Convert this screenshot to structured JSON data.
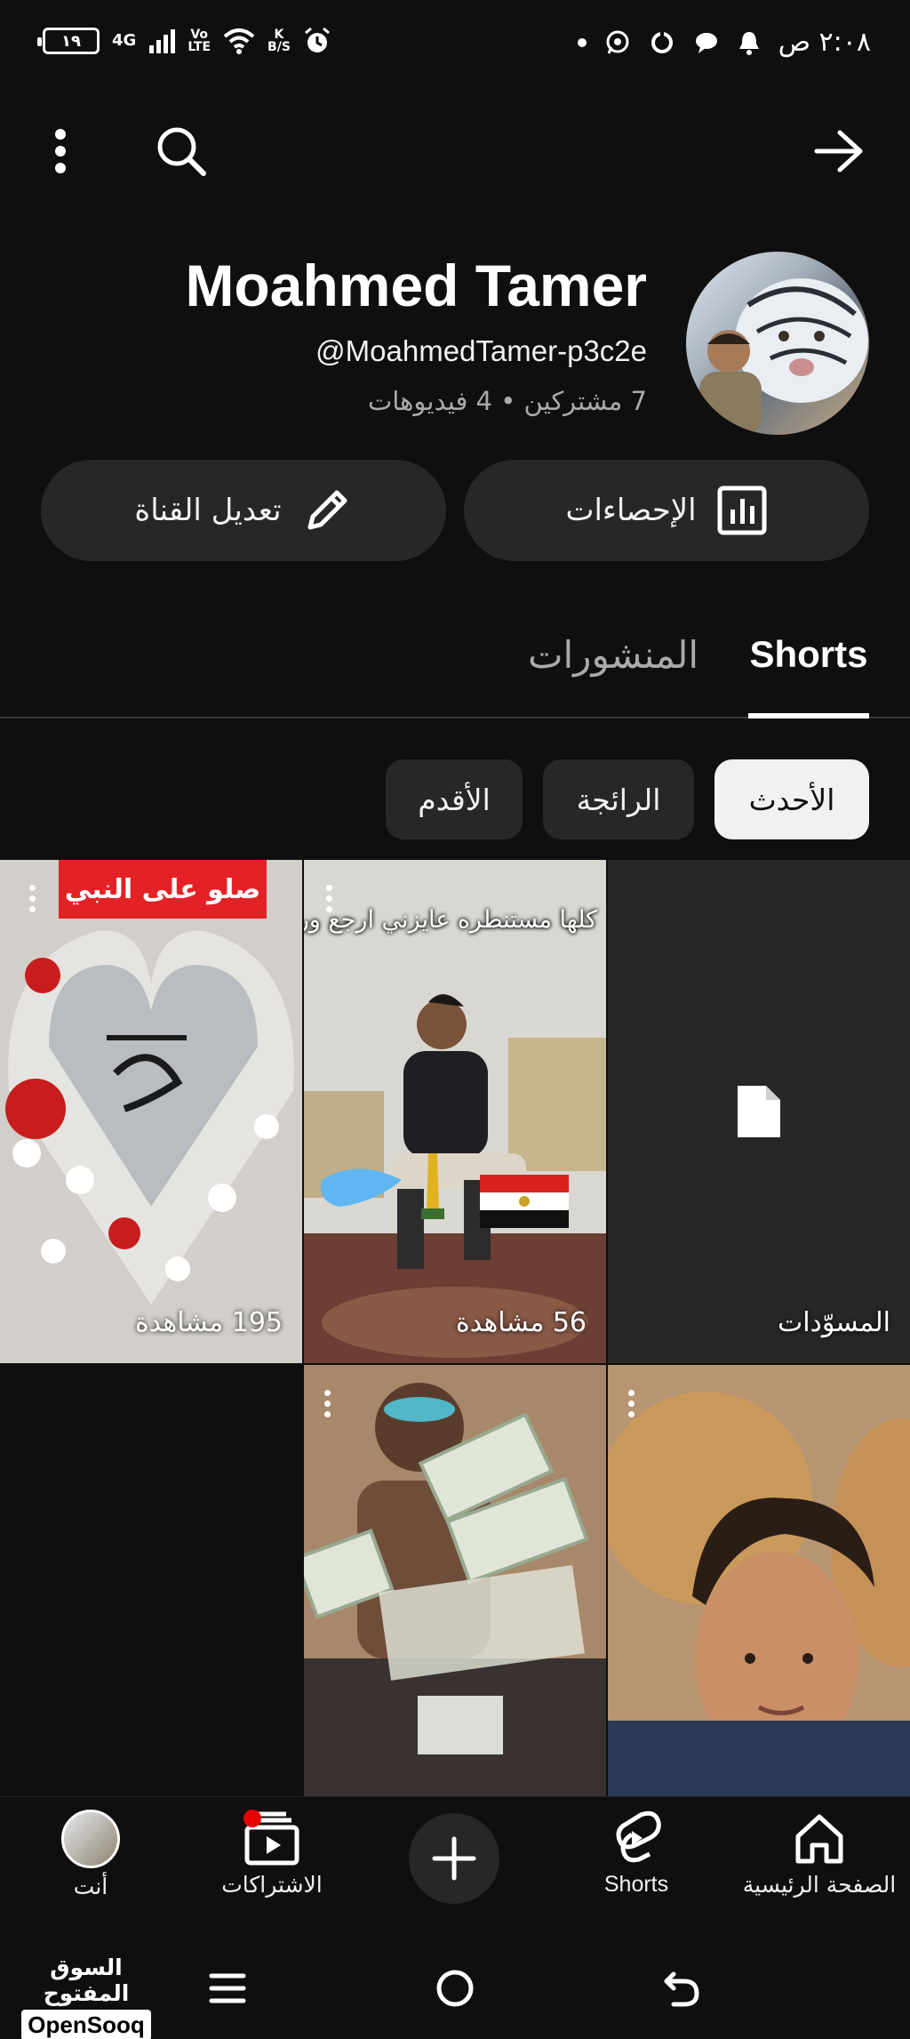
{
  "status_bar": {
    "battery": "١٩",
    "network": "4G",
    "volte_top": "Vo",
    "volte_bottom": "LTE",
    "speed_top": "K",
    "speed_bottom": "B/S",
    "time": "٢:٠٨ ص"
  },
  "app_bar": {
    "back_icon": "arrow-right-icon",
    "search_icon": "search-icon",
    "more_icon": "more-vert-icon"
  },
  "channel": {
    "name": "Moahmed Tamer",
    "handle": "@MoahmedTamer-p3c2e",
    "meta": "7 مشتركين • 4 فيديوهات"
  },
  "actions": {
    "analytics_label": "الإحصاءات",
    "edit_label": "تعديل القناة"
  },
  "tabs": {
    "shorts": "Shorts",
    "posts": "المنشورات"
  },
  "chips": {
    "latest": "الأحدث",
    "popular": "الرائجة",
    "oldest": "الأقدم"
  },
  "grid": {
    "drafts_label": "المسوّدات",
    "tile2_caption": "كلها مستنطره عايزني ارجع وراه",
    "tile2_views": "56 مشاهدة",
    "tile3_banner": "صلو على النبي",
    "tile3_views": "195 مشاهدة"
  },
  "bottom_nav": {
    "home": "الصفحة الرئيسية",
    "shorts": "Shorts",
    "subscriptions": "الاشتراكات",
    "you": "أنت"
  },
  "watermark": {
    "arabic": "السوق المفتوح",
    "english": "OpenSooq"
  }
}
